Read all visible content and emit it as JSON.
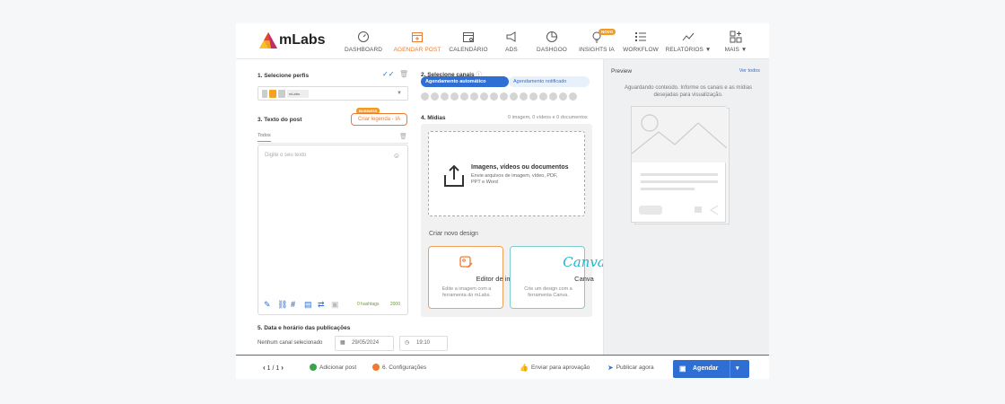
{
  "app": {
    "brand": "mLabs"
  },
  "nav": {
    "items": [
      {
        "label": "DASHBOARD",
        "icon": "gauge-icon"
      },
      {
        "label": "AGENDAR POST",
        "icon": "calendar-plus-icon",
        "active": true
      },
      {
        "label": "CALENDÁRIO",
        "icon": "calendar-icon"
      },
      {
        "label": "ADS",
        "icon": "megaphone-icon"
      },
      {
        "label": "DASHGOO",
        "icon": "pie-chart-icon"
      },
      {
        "label": "INSIGHTS IA",
        "icon": "lightbulb-icon",
        "badge": "NOVO"
      },
      {
        "label": "WORKFLOW",
        "icon": "checklist-icon"
      },
      {
        "label": "RELATÓRIOS ▼",
        "icon": "line-chart-icon"
      },
      {
        "label": "MAIS ▼",
        "icon": "grid-plus-icon"
      }
    ]
  },
  "left": {
    "step1_title": "1. Selecione perfis",
    "profile_chip": "mLabs",
    "step3_title": "3. Texto do post",
    "criar_legenda": "Criar legenda - IA",
    "criar_badge": "BUSINESS",
    "tab_todos": "Todos",
    "placeholder": "Digite o seu texto",
    "hashtags": "0 hashtags",
    "char_count": "2000",
    "step5_title": "5. Data e horário das publicações",
    "nenhum": "Nenhum canal selecionado",
    "date": "29/05/2024",
    "time": "19:10"
  },
  "middle": {
    "step2_title": "2. Selecione canais",
    "pill_auto": "Agendamento automático",
    "pill_notif": "Agendamento notificado",
    "step4_title": "4. Mídias",
    "midias_count": "0 imagem, 0 vídeos e 0 documentos",
    "drop_title": "Imagens, vídeos ou documentos",
    "drop_sub": "Envie arquivos de imagem, vídeo, PDF, PPT e Word",
    "criar_novo": "Criar novo design",
    "editor_title": "Editor de imagem",
    "editor_sub": "Edite a imagem com a ferramenta do mLabs.",
    "canva_logo": "Canva",
    "canva_title": "Canva",
    "canva_sub": "Crie um design com a ferramenta Canva."
  },
  "preview": {
    "title": "Preview",
    "ver_todos": "Ver todos",
    "aguardando": "Aguardando conteúdo. Informe os canais e as mídias desejadas para visualização."
  },
  "bottom": {
    "pager": "1 / 1",
    "adicionar": "Adicionar post",
    "configuracoes": "6. Configurações",
    "enviar": "Enviar para aprovação",
    "publicar": "Publicar agora",
    "agendar": "Agendar"
  },
  "colors": {
    "accent": "#f07a2f",
    "primary": "#2f6fd4"
  }
}
